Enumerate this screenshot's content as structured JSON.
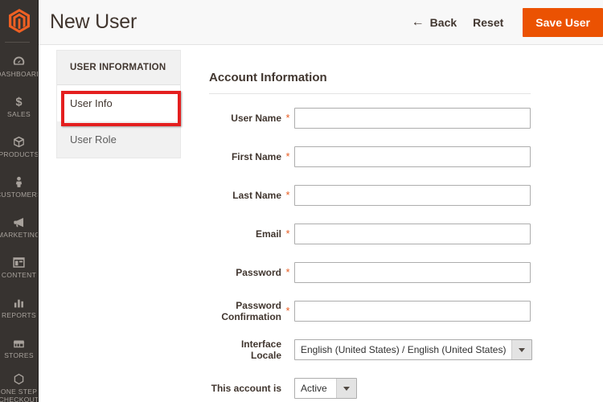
{
  "sidebar": {
    "logo_name": "magento-logo-icon",
    "items": [
      {
        "label": "DASHBOARD",
        "icon": "dashboard-icon",
        "name": "sidebar-item-dashboard"
      },
      {
        "label": "SALES",
        "icon": "dollar-icon",
        "name": "sidebar-item-sales"
      },
      {
        "label": "PRODUCTS",
        "icon": "box-icon",
        "name": "sidebar-item-products"
      },
      {
        "label": "CUSTOMERS",
        "icon": "person-icon",
        "name": "sidebar-item-customers"
      },
      {
        "label": "MARKETING",
        "icon": "megaphone-icon",
        "name": "sidebar-item-marketing"
      },
      {
        "label": "CONTENT",
        "icon": "layout-icon",
        "name": "sidebar-item-content"
      },
      {
        "label": "REPORTS",
        "icon": "bar-chart-icon",
        "name": "sidebar-item-reports"
      },
      {
        "label": "STORES",
        "icon": "storefront-icon",
        "name": "sidebar-item-stores"
      },
      {
        "label": "ONE STEP\nCHECKOUT",
        "icon": "hexagon-icon",
        "name": "sidebar-item-one-step-checkout"
      }
    ]
  },
  "header": {
    "title": "New User",
    "back_label": "Back",
    "back_icon": "arrow-left-icon",
    "reset_label": "Reset",
    "save_label": "Save User",
    "save_color": "#eb5202"
  },
  "tabs": {
    "panel_title": "USER INFORMATION",
    "items": [
      {
        "label": "User Info",
        "active": true,
        "name": "tab-user-info"
      },
      {
        "label": "User Role",
        "active": false,
        "name": "tab-user-role"
      }
    ],
    "highlight_color": "#e41f1f"
  },
  "form": {
    "section_title": "Account Information",
    "required_marker": "*",
    "fields": [
      {
        "label": "User Name",
        "required": true,
        "type": "text",
        "value": "",
        "name": "user-name-field"
      },
      {
        "label": "First Name",
        "required": true,
        "type": "text",
        "value": "",
        "name": "first-name-field"
      },
      {
        "label": "Last Name",
        "required": true,
        "type": "text",
        "value": "",
        "name": "last-name-field"
      },
      {
        "label": "Email",
        "required": true,
        "type": "text",
        "value": "",
        "name": "email-field"
      },
      {
        "label": "Password",
        "required": true,
        "type": "text",
        "value": "",
        "name": "password-field"
      },
      {
        "label": "Password Confirmation",
        "required": true,
        "type": "text",
        "value": "",
        "name": "password-confirmation-field"
      },
      {
        "label": "Interface Locale",
        "required": false,
        "type": "select",
        "value": "English (United States) / English (United States)",
        "width": "full",
        "name": "interface-locale-select"
      },
      {
        "label": "This account is",
        "required": false,
        "type": "select",
        "value": "Active",
        "width": "short",
        "name": "account-status-select"
      }
    ]
  }
}
